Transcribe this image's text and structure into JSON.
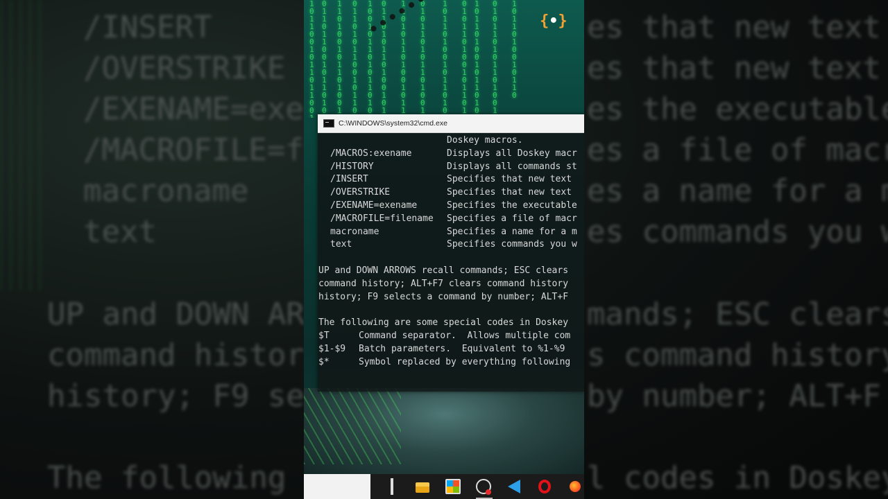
{
  "background": {
    "blurred_lines": [
      "/INSERT",
      "/OVERSTRIKE",
      "/EXENAME=exe",
      "/MACROFILE=fi",
      "macroname",
      "text",
      "UP and DOWN AR",
      "command histor",
      "history; F9 se",
      "The following"
    ],
    "blurred_right_lines": [
      "es that new text",
      "es that new text",
      "es the executable",
      "es a file of macr",
      "es a name for a m",
      "es commands you w",
      "mands; ESC clears",
      "s command history",
      "by number; ALT+F",
      "l codes in Doskey"
    ]
  },
  "logo": {
    "left": "{",
    "dot": "•",
    "right": "}"
  },
  "cmd": {
    "title": "C:\\WINDOWS\\system32\\cmd.exe",
    "lines": [
      {
        "kind": "cont",
        "desc": "Doskey macros."
      },
      {
        "kind": "opt",
        "opt": "/MACROS:exename",
        "desc": "Displays all Doskey macr"
      },
      {
        "kind": "opt",
        "opt": "/HISTORY",
        "desc": "Displays all commands st"
      },
      {
        "kind": "opt",
        "opt": "/INSERT",
        "desc": "Specifies that new text"
      },
      {
        "kind": "opt",
        "opt": "/OVERSTRIKE",
        "desc": "Specifies that new text"
      },
      {
        "kind": "opt",
        "opt": "/EXENAME=exename",
        "desc": "Specifies the executable"
      },
      {
        "kind": "opt",
        "opt": "/MACROFILE=filename",
        "desc": "Specifies a file of macr"
      },
      {
        "kind": "opt",
        "opt": "macroname",
        "desc": "Specifies a name for a m"
      },
      {
        "kind": "opt",
        "opt": "text",
        "desc": "Specifies commands you w"
      },
      {
        "kind": "blank"
      },
      {
        "kind": "full",
        "text": "UP and DOWN ARROWS recall commands; ESC clears"
      },
      {
        "kind": "full",
        "text": "command history; ALT+F7 clears command history"
      },
      {
        "kind": "full",
        "text": "history; F9 selects a command by number; ALT+F"
      },
      {
        "kind": "blank"
      },
      {
        "kind": "full",
        "text": "The following are some special codes in Doskey"
      },
      {
        "kind": "code",
        "opt": "$T",
        "desc": "Command separator.  Allows multiple com"
      },
      {
        "kind": "code",
        "opt": "$1-$9",
        "desc": "Batch parameters.  Equivalent to %1-%9"
      },
      {
        "kind": "code",
        "opt": "$*",
        "desc": "Symbol replaced by everything following"
      }
    ]
  },
  "taskbar": {
    "icons": [
      "task-view-icon",
      "file-explorer-icon",
      "store-icon",
      "performance-monitor-icon",
      "vscode-icon",
      "opera-icon",
      "firefox-icon"
    ]
  }
}
